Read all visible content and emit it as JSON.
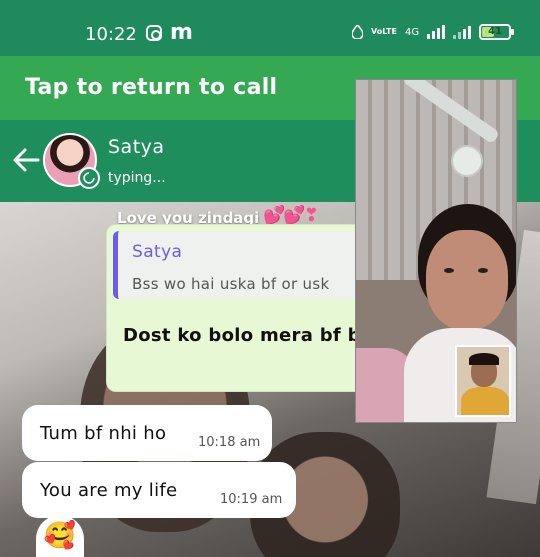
{
  "status_bar": {
    "time": "10:22",
    "carrier_label": "VoLTE",
    "network": "4G",
    "battery": "41",
    "battery_level": 0.41,
    "colors": {
      "background": "#1f8a5c",
      "battery_fill": "#b6e37a"
    }
  },
  "call_banner": {
    "text": "Tap to return to call",
    "color": "#34a853"
  },
  "chat_header": {
    "contact_name": "Satya",
    "status": "typing...",
    "color": "#1e8e5c"
  },
  "messages": {
    "top_preview": "Love you zindagi",
    "top_preview_emoji": "💕💕❣",
    "outgoing": {
      "quote_author": "Satya",
      "quote_text": "Bss wo hai uska bf or usk",
      "text": "Dost ko bolo mera bf b",
      "color": "#e6f9d4",
      "quote_accent": "#6c5ce7"
    },
    "incoming": [
      {
        "text": "Tum bf nhi ho",
        "time": "10:18 am"
      },
      {
        "text": "You are my life",
        "time": "10:19 am"
      }
    ],
    "reaction_emoji": "🥰"
  },
  "video_call_pip": {
    "label": "video-call-overlay"
  }
}
